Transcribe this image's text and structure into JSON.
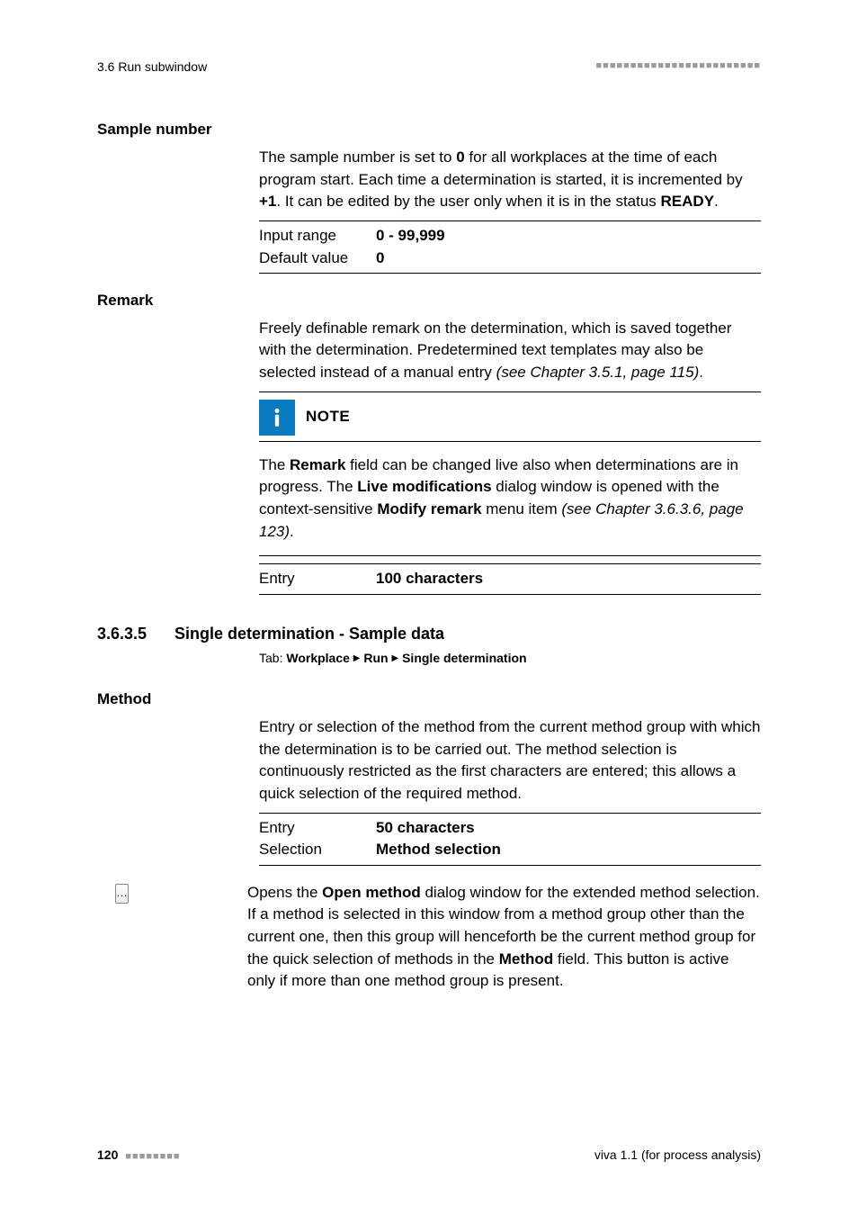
{
  "header": {
    "section_ref": "3.6 Run subwindow"
  },
  "sample_number": {
    "heading": "Sample number",
    "para_parts": {
      "p1": "The sample number is set to ",
      "p2": "0",
      "p3": " for all workplaces at the time of each program start. Each time a determination is started, it is incremented by ",
      "p4": "+1",
      "p5": ". It can be edited by the user only when it is in the status ",
      "p6": "READY",
      "p7": "."
    },
    "table": {
      "row1_label": "Input range",
      "row1_value": "0 - 99,999",
      "row2_label": "Default value",
      "row2_value": "0"
    }
  },
  "remark": {
    "heading": "Remark",
    "para": "Freely definable remark on the determination, which is saved together with the determination. Predetermined text templates may also be selected instead of a manual entry ",
    "para_ref": "(see Chapter 3.5.1, page 115)",
    "para_end": ".",
    "note_title": "NOTE",
    "note_parts": {
      "n1": "The ",
      "n2": "Remark",
      "n3": " field can be changed live also when determinations are in progress. The ",
      "n4": "Live modifications",
      "n5": " dialog window is opened with the context-sensitive ",
      "n6": "Modify remark",
      "n7": " menu item ",
      "n8": "(see Chapter 3.6.3.6, page 123)",
      "n9": "."
    },
    "table": {
      "row1_label": "Entry",
      "row1_value": "100 characters"
    }
  },
  "section": {
    "number": "3.6.3.5",
    "title": "Single determination - Sample data",
    "tab_label": "Tab: ",
    "breadcrumb": {
      "a": "Workplace",
      "b": "Run",
      "c": "Single determination"
    }
  },
  "method": {
    "heading": "Method",
    "para": "Entry or selection of the method from the current method group with which the determination is to be carried out. The method selection is continuously restricted as the first characters are entered; this allows a quick selection of the required method.",
    "table": {
      "row1_label": "Entry",
      "row1_value": "50 characters",
      "row2_label": "Selection",
      "row2_value": "Method selection"
    },
    "open_parts": {
      "o1": "Opens the ",
      "o2": "Open method",
      "o3": " dialog window for the extended method selection. If a method is selected in this window from a method group other than the current one, then this group will henceforth be the current method group for the quick selection of methods in the ",
      "o4": "Method",
      "o5": " field. This button is active only if more than one method group is present."
    }
  },
  "footer": {
    "page": "120",
    "right": "viva 1.1 (for process analysis)"
  }
}
